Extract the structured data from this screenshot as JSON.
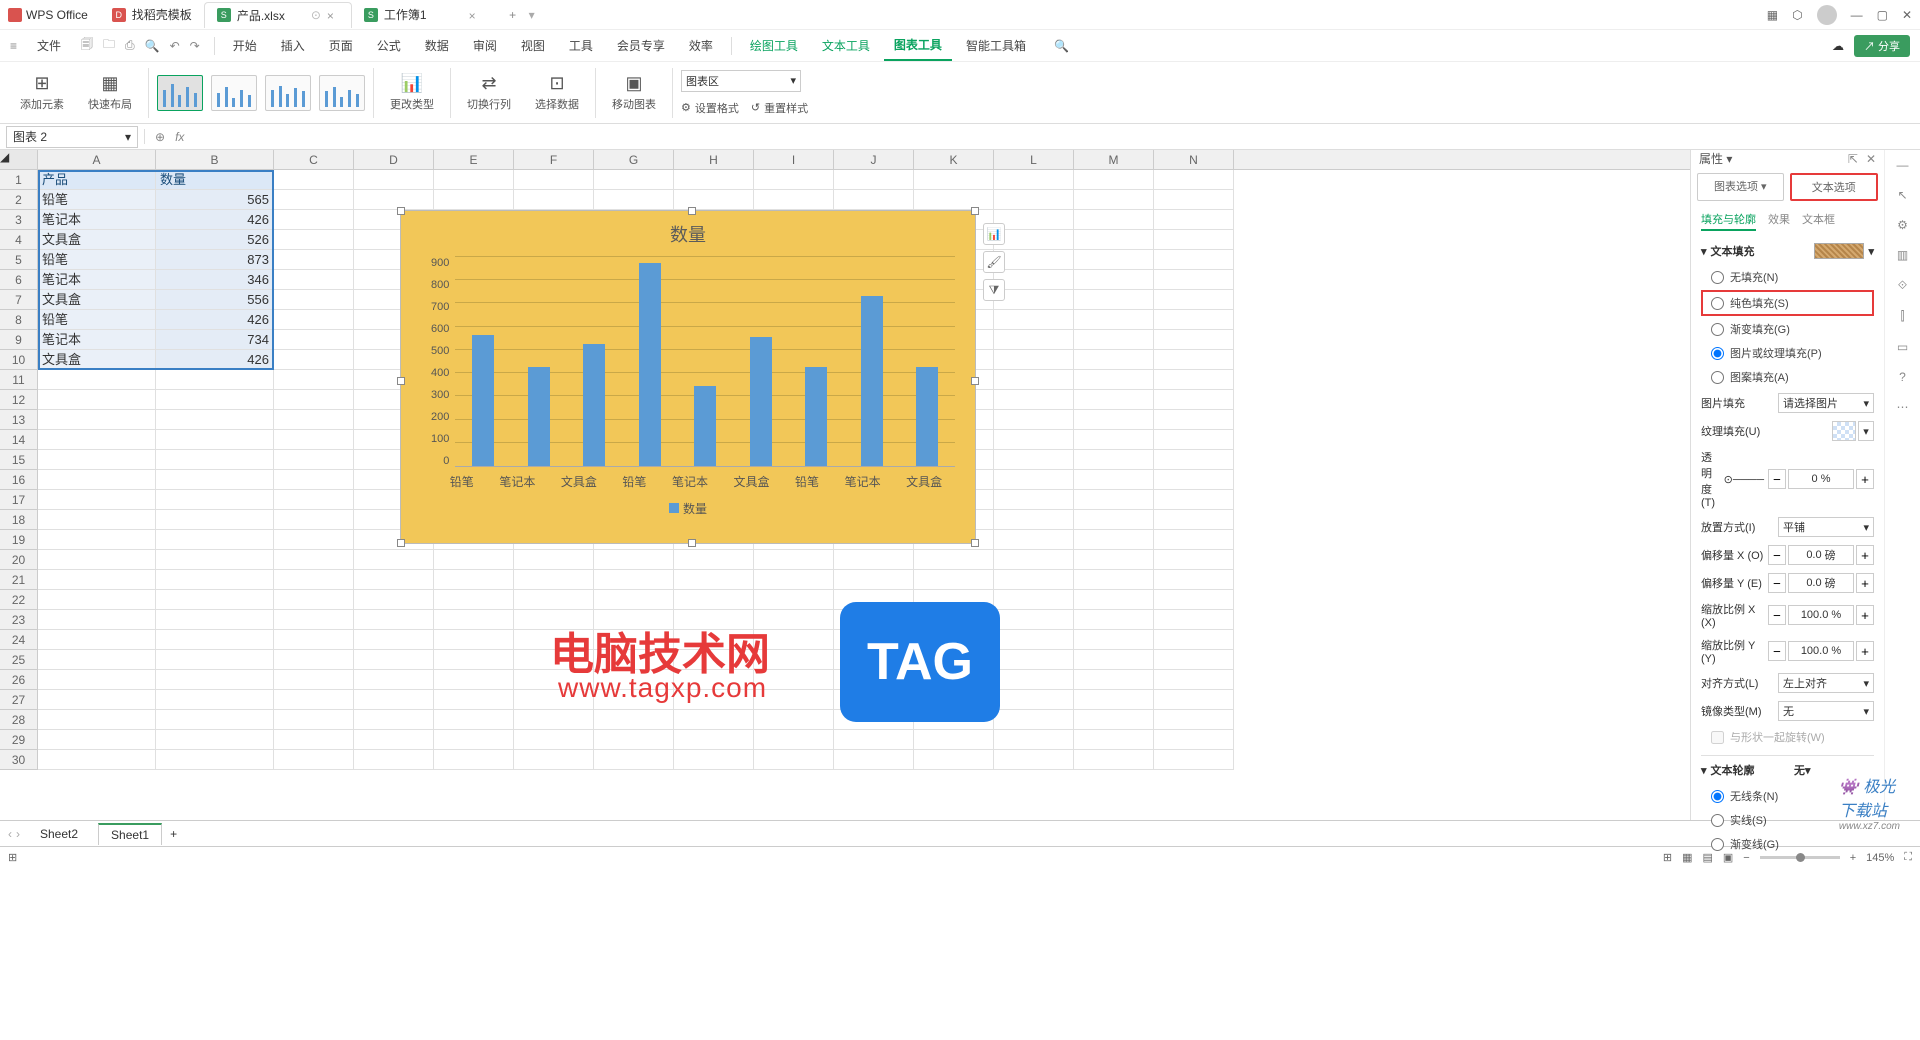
{
  "titlebar": {
    "app_name": "WPS Office",
    "tabs": [
      {
        "icon": "d",
        "label": "找稻壳模板"
      },
      {
        "icon": "s",
        "label": "产品.xlsx",
        "active": true
      },
      {
        "icon": "s",
        "label": "工作簿1"
      }
    ]
  },
  "menubar": {
    "file_label": "文件",
    "items": [
      "开始",
      "插入",
      "页面",
      "公式",
      "数据",
      "审阅",
      "视图",
      "工具",
      "会员专享",
      "效率"
    ],
    "green_items": [
      "绘图工具",
      "文本工具",
      "图表工具",
      "智能工具箱"
    ],
    "active_item": "图表工具",
    "share_label": "分享"
  },
  "ribbon": {
    "add_element": "添加元素",
    "quick_layout": "快速布局",
    "change_type": "更改类型",
    "switch_rc": "切换行列",
    "select_data": "选择数据",
    "move_chart": "移动图表",
    "chart_area_label": "图表区",
    "set_format": "设置格式",
    "reset_style": "重置样式"
  },
  "formula_bar": {
    "name_box": "图表 2",
    "fx": "fx"
  },
  "columns": [
    "A",
    "B",
    "C",
    "D",
    "E",
    "F",
    "G",
    "H",
    "I",
    "J",
    "K",
    "L",
    "M",
    "N"
  ],
  "data_rows": [
    {
      "r": 1,
      "a": "产品",
      "b": "数量"
    },
    {
      "r": 2,
      "a": "铅笔",
      "b": "565"
    },
    {
      "r": 3,
      "a": "笔记本",
      "b": "426"
    },
    {
      "r": 4,
      "a": "文具盒",
      "b": "526"
    },
    {
      "r": 5,
      "a": "铅笔",
      "b": "873"
    },
    {
      "r": 6,
      "a": "笔记本",
      "b": "346"
    },
    {
      "r": 7,
      "a": "文具盒",
      "b": "556"
    },
    {
      "r": 8,
      "a": "铅笔",
      "b": "426"
    },
    {
      "r": 9,
      "a": "笔记本",
      "b": "734"
    },
    {
      "r": 10,
      "a": "文具盒",
      "b": "426"
    }
  ],
  "chart_data": {
    "type": "bar",
    "title": "数量",
    "categories": [
      "铅笔",
      "笔记本",
      "文具盒",
      "铅笔",
      "笔记本",
      "文具盒",
      "铅笔",
      "笔记本",
      "文具盒"
    ],
    "values": [
      565,
      426,
      526,
      873,
      346,
      556,
      426,
      734,
      426
    ],
    "legend": "数量",
    "ylim": [
      0,
      900
    ],
    "yticks": [
      0,
      100,
      200,
      300,
      400,
      500,
      600,
      700,
      800,
      900
    ]
  },
  "prop_panel": {
    "title": "属性",
    "chart_option": "图表选项",
    "text_option": "文本选项",
    "tabs": [
      "填充与轮廓",
      "效果",
      "文本框"
    ],
    "section_fill_title": "文本填充",
    "fill_options": {
      "none": "无填充(N)",
      "solid": "纯色填充(S)",
      "gradient": "渐变填充(G)",
      "picture": "图片或纹理填充(P)",
      "pattern": "图案填充(A)"
    },
    "pic_fill_label": "图片填充",
    "pic_fill_value": "请选择图片",
    "texture_label": "纹理填充(U)",
    "transparency_label": "透明度(T)",
    "transparency_value": "0",
    "transparency_unit": "%",
    "tile_label": "放置方式(I)",
    "tile_value": "平铺",
    "offset_x_label": "偏移量 X (O)",
    "offset_x_value": "0.0",
    "offset_unit": "磅",
    "offset_y_label": "偏移量 Y (E)",
    "offset_y_value": "0.0",
    "scale_x_label": "缩放比例 X (X)",
    "scale_x_value": "100.0",
    "scale_unit": "%",
    "scale_y_label": "缩放比例 Y (Y)",
    "scale_y_value": "100.0",
    "align_label": "对齐方式(L)",
    "align_value": "左上对齐",
    "mirror_label": "镜像类型(M)",
    "mirror_value": "无",
    "rotate_label": "与形状一起旋转(W)",
    "section_outline_title": "文本轮廓",
    "outline_value": "无",
    "outline_options": {
      "none": "无线条(N)",
      "solid": "实线(S)",
      "gradient": "渐变线(G)"
    }
  },
  "sheet_tabs": {
    "tabs": [
      "Sheet2",
      "Sheet1"
    ],
    "active": "Sheet1"
  },
  "statusbar": {
    "zoom": "145%"
  },
  "watermark": {
    "text1": "电脑技术网",
    "url": "www.tagxp.com",
    "tag": "TAG",
    "text2": "极光下载站",
    "url2": "www.xz7.com"
  }
}
